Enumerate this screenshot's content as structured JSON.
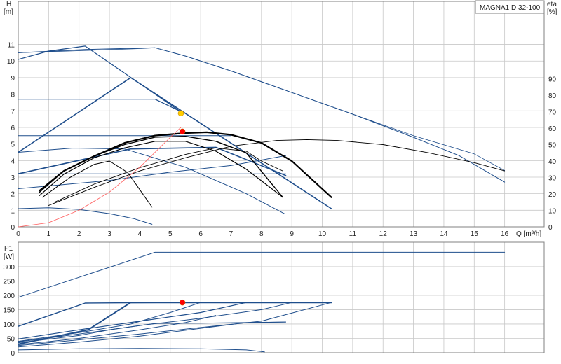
{
  "title": "MAGNA1 D 32-100",
  "colors": {
    "grid": "#c8c8c8",
    "blue": "#1f4e8c",
    "black": "#000000",
    "red_curve": "#ff5a5a",
    "op_red": "#ff0000",
    "op_yellow": "#ffcc00"
  },
  "chart_data": [
    {
      "type": "line",
      "title": "MAGNA1 D 32-100",
      "xlabel": "Q [m³/h]",
      "ylabel": "H [m]",
      "y2label": "eta [%]",
      "xlim": [
        0,
        17.3
      ],
      "ylim": [
        0,
        13.6
      ],
      "y2lim": [
        0,
        137
      ],
      "x_ticks": [
        "0",
        "1",
        "2",
        "3",
        "4",
        "5",
        "6",
        "7",
        "8",
        "9",
        "10",
        "11",
        "12",
        "13",
        "14",
        "15",
        "16"
      ],
      "y_ticks": [
        "0",
        "1",
        "2",
        "3",
        "4",
        "5",
        "6",
        "7",
        "8",
        "9",
        "10",
        "11"
      ],
      "y2_ticks": [
        "0",
        "10",
        "20",
        "30",
        "40",
        "50",
        "60",
        "70",
        "80",
        "90"
      ],
      "grid": true,
      "series": [
        {
          "group": "H-blue",
          "color": "blue",
          "width": 1.6,
          "points": [
            [
              0,
              4.5
            ],
            [
              3.7,
              9.0
            ],
            [
              10.3,
              1.1
            ]
          ]
        },
        {
          "group": "H-blue",
          "color": "blue",
          "width": 1.6,
          "points": [
            [
              0,
              3.2
            ],
            [
              3.7,
              4.7
            ],
            [
              6.5,
              4.8
            ],
            [
              8.8,
              3.1
            ]
          ]
        },
        {
          "group": "H-blue",
          "color": "blue",
          "width": 1.2,
          "points": [
            [
              0,
              10.1
            ],
            [
              1,
              10.6
            ],
            [
              2.2,
              10.9
            ],
            [
              5.3,
              7.0
            ]
          ]
        },
        {
          "group": "H-blue",
          "color": "blue",
          "width": 1.2,
          "points": [
            [
              0,
              7.7
            ],
            [
              4.5,
              7.7
            ],
            [
              5.3,
              7.0
            ]
          ]
        },
        {
          "group": "H-blue",
          "color": "blue",
          "width": 1.0,
          "points": [
            [
              0,
              5.5
            ],
            [
              7.0,
              5.5
            ]
          ]
        },
        {
          "group": "H-blue",
          "color": "blue",
          "width": 1.0,
          "points": [
            [
              0,
              3.2
            ],
            [
              8.8,
              3.2
            ]
          ]
        },
        {
          "group": "H-blue",
          "color": "blue",
          "width": 1.0,
          "points": [
            [
              0,
              4.5
            ],
            [
              1.8,
              4.75
            ],
            [
              3.5,
              4.7
            ],
            [
              5.5,
              3.6
            ],
            [
              7.5,
              2.0
            ],
            [
              8.75,
              0.8
            ]
          ]
        },
        {
          "group": "H-blue",
          "color": "blue",
          "width": 1.0,
          "points": [
            [
              0,
              2.3
            ],
            [
              3,
              2.8
            ],
            [
              5,
              3.3
            ],
            [
              7,
              3.7
            ],
            [
              8.8,
              4.3
            ]
          ]
        },
        {
          "group": "H-blue",
          "color": "blue",
          "width": 1.0,
          "points": [
            [
              0,
              1.1
            ],
            [
              1,
              1.15
            ],
            [
              2,
              1.05
            ],
            [
              3,
              0.8
            ],
            [
              3.8,
              0.5
            ],
            [
              4.4,
              0.15
            ]
          ]
        },
        {
          "group": "H-blue",
          "color": "blue",
          "width": 1.0,
          "points": [
            [
              0,
              10.5
            ],
            [
              2.2,
              10.7
            ],
            [
              4.5,
              10.8
            ],
            [
              5.5,
              10.3
            ],
            [
              7,
              9.4
            ],
            [
              9,
              8.1
            ],
            [
              11,
              6.8
            ],
            [
              13,
              5.4
            ],
            [
              14.5,
              4.3
            ],
            [
              16,
              2.7
            ]
          ]
        },
        {
          "group": "H-blue",
          "color": "blue",
          "width": 0.8,
          "points": [
            [
              0,
              10.5
            ],
            [
              4,
              10.75
            ],
            [
              4.5,
              10.8
            ],
            [
              5.5,
              10.3
            ],
            [
              7,
              9.4
            ],
            [
              9,
              8.1
            ],
            [
              11,
              6.8
            ],
            [
              13,
              5.5
            ],
            [
              15,
              4.4
            ],
            [
              16,
              3.4
            ]
          ]
        },
        {
          "group": "eta-black",
          "color": "black",
          "width": 2.2,
          "points": [
            [
              0.7,
              22
            ],
            [
              1.5,
              34
            ],
            [
              2.5,
              43
            ],
            [
              3.5,
              51
            ],
            [
              4.5,
              55.5
            ],
            [
              5.5,
              57
            ],
            [
              6.2,
              57.5
            ],
            [
              7,
              56
            ],
            [
              8,
              51
            ],
            [
              9,
              40
            ],
            [
              10.3,
              18
            ]
          ]
        },
        {
          "group": "eta-black",
          "color": "black",
          "width": 1.4,
          "points": [
            [
              0.7,
              21
            ],
            [
              1.5,
              34
            ],
            [
              2.5,
              43
            ],
            [
              3.5,
              50
            ],
            [
              4.5,
              54.5
            ],
            [
              5.5,
              55
            ],
            [
              6.5,
              52
            ],
            [
              7.5,
              45
            ],
            [
              8.7,
              18
            ]
          ]
        },
        {
          "group": "eta-black",
          "color": "black",
          "width": 1.2,
          "points": [
            [
              0.7,
              19
            ],
            [
              1.5,
              32
            ],
            [
              2.5,
              42
            ],
            [
              3.5,
              48
            ],
            [
              4.5,
              52
            ],
            [
              5.5,
              52
            ],
            [
              6.5,
              46
            ],
            [
              7.5,
              35
            ],
            [
              8.0,
              28
            ],
            [
              8.7,
              18
            ]
          ]
        },
        {
          "group": "eta-black",
          "color": "black",
          "width": 1.0,
          "points": [
            [
              0.8,
              18
            ],
            [
              1.7,
              30
            ],
            [
              2.5,
              38
            ],
            [
              3.0,
              40
            ],
            [
              3.6,
              33
            ],
            [
              4.4,
              12
            ]
          ]
        },
        {
          "group": "eta-black",
          "color": "black",
          "width": 0.9,
          "points": [
            [
              1,
              13
            ],
            [
              2.5,
              24
            ],
            [
              4,
              34
            ],
            [
              5.5,
              42
            ],
            [
              7,
              49
            ],
            [
              8.5,
              52.5
            ],
            [
              9.5,
              53
            ],
            [
              10.5,
              52.5
            ],
            [
              12,
              50
            ],
            [
              13.5,
              45
            ],
            [
              15,
              39
            ],
            [
              16,
              34
            ]
          ]
        },
        {
          "group": "eta-black",
          "color": "black",
          "width": 0.9,
          "points": [
            [
              1.2,
              15
            ],
            [
              2.5,
              26
            ],
            [
              4,
              36
            ],
            [
              5.5,
              44
            ],
            [
              6.5,
              48
            ],
            [
              7.5,
              46
            ],
            [
              8,
              40
            ],
            [
              8.7,
              34
            ]
          ]
        },
        {
          "group": "system-red",
          "color": "red_curve",
          "width": 0.8,
          "points": [
            [
              0,
              0
            ],
            [
              1,
              0.25
            ],
            [
              2,
              1.0
            ],
            [
              3,
              2.1
            ],
            [
              4,
              3.6
            ],
            [
              5,
              5.4
            ],
            [
              5.35,
              6.0
            ]
          ]
        }
      ],
      "operating_points": [
        {
          "x": 5.35,
          "y": 6.85,
          "color": "op_yellow"
        },
        {
          "x": 5.4,
          "y": 5.75,
          "color": "op_red"
        }
      ]
    },
    {
      "type": "line",
      "xlabel": "",
      "ylabel": "P1 [W]",
      "xlim": [
        0,
        17.3
      ],
      "ylim": [
        0,
        385
      ],
      "y_ticks": [
        "0",
        "50",
        "100",
        "150",
        "200",
        "250",
        "300"
      ],
      "grid": true,
      "series": [
        {
          "group": "P1-blue",
          "color": "blue",
          "width": 1.0,
          "points": [
            [
              0,
              193
            ],
            [
              4.5,
              350
            ],
            [
              16,
              350
            ]
          ]
        },
        {
          "group": "P1-blue",
          "color": "blue",
          "width": 2.0,
          "points": [
            [
              0,
              30
            ],
            [
              2.3,
              80
            ],
            [
              3.7,
              175
            ],
            [
              10.3,
              175
            ]
          ]
        },
        {
          "group": "P1-blue",
          "color": "blue",
          "width": 1.4,
          "points": [
            [
              0,
              92
            ],
            [
              2.2,
              173
            ],
            [
              5,
              175
            ],
            [
              10.3,
              175
            ]
          ]
        },
        {
          "group": "P1-blue",
          "color": "blue",
          "width": 1.2,
          "points": [
            [
              0,
              48
            ],
            [
              2,
              80
            ],
            [
              4,
              110
            ],
            [
              6,
              140
            ],
            [
              7.5,
              175
            ],
            [
              10.3,
              175
            ]
          ]
        },
        {
          "group": "P1-blue",
          "color": "blue",
          "width": 1.0,
          "points": [
            [
              0,
              38
            ],
            [
              2,
              65
            ],
            [
              4,
              95
            ],
            [
              6,
              120
            ],
            [
              8,
              150
            ],
            [
              9,
              175
            ]
          ]
        },
        {
          "group": "P1-blue",
          "color": "blue",
          "width": 1.0,
          "points": [
            [
              0,
              25
            ],
            [
              2,
              45
            ],
            [
              4,
              65
            ],
            [
              6,
              88
            ],
            [
              8,
              110
            ],
            [
              10.3,
              175
            ]
          ]
        },
        {
          "group": "P1-blue",
          "color": "blue",
          "width": 1.0,
          "points": [
            [
              0,
              20
            ],
            [
              2,
              37
            ],
            [
              4,
              58
            ],
            [
              6,
              85
            ],
            [
              7.5,
              105
            ],
            [
              8.8,
              107
            ]
          ]
        },
        {
          "group": "P1-blue",
          "color": "blue",
          "width": 1.0,
          "points": [
            [
              0,
              35
            ],
            [
              2,
              60
            ],
            [
              3,
              80
            ],
            [
              4.5,
              102
            ],
            [
              6,
              103
            ],
            [
              8.8,
              107
            ]
          ]
        },
        {
          "group": "P1-blue",
          "color": "blue",
          "width": 1.0,
          "points": [
            [
              0,
              40
            ],
            [
              2,
              70
            ],
            [
              3.7,
              100
            ],
            [
              5,
              140
            ],
            [
              6,
              175
            ]
          ]
        },
        {
          "group": "P1-blue",
          "color": "blue",
          "width": 1.0,
          "points": [
            [
              0,
              28
            ],
            [
              2,
              50
            ],
            [
              4,
              80
            ],
            [
              5.5,
              105
            ],
            [
              6.5,
              130
            ]
          ]
        },
        {
          "group": "P1-blue",
          "color": "blue",
          "width": 1.0,
          "points": [
            [
              0,
              10
            ],
            [
              2,
              14
            ],
            [
              4,
              15
            ],
            [
              6,
              14
            ],
            [
              7.5,
              10
            ],
            [
              8.1,
              3
            ]
          ]
        }
      ],
      "operating_points": [
        {
          "x": 5.4,
          "y": 175,
          "color": "op_red"
        }
      ]
    }
  ]
}
